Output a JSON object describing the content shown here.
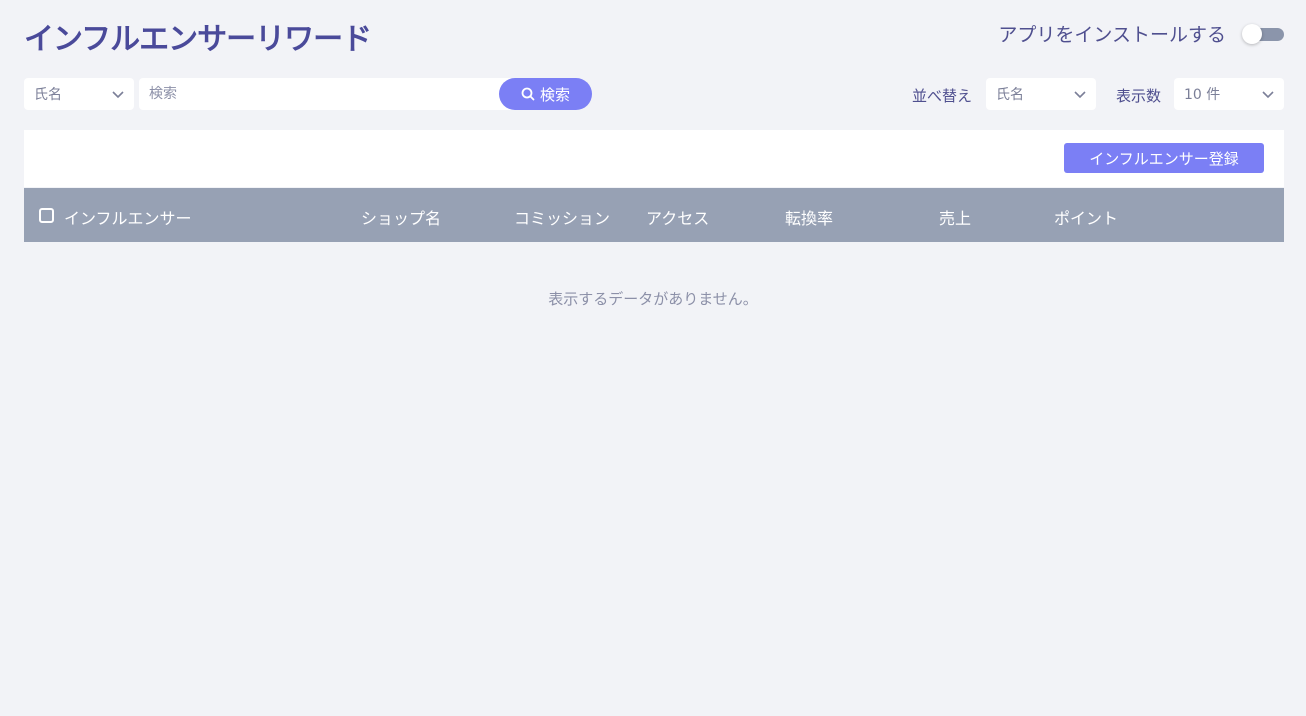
{
  "header": {
    "title": "インフルエンサーリワード",
    "install_label": "アプリをインストールする",
    "install_toggle_on": false
  },
  "toolbar": {
    "filter_select": {
      "selected": "氏名"
    },
    "search": {
      "placeholder": "検索",
      "value": ""
    },
    "search_button_label": "検索",
    "sort_label": "並べ替え",
    "sort_select": {
      "selected": "氏名"
    },
    "count_label": "表示数",
    "count_select": {
      "selected": "10 件"
    }
  },
  "actions": {
    "register_label": "インフルエンサー登録"
  },
  "table": {
    "columns": [
      "インフルエンサー",
      "ショップ名",
      "コミッション",
      "アクセス",
      "転換率",
      "売上",
      "ポイント"
    ],
    "rows": [],
    "empty_message": "表示するデータがありません。"
  },
  "colors": {
    "accent": "#7b7ff5",
    "title": "#4a4a9a",
    "header_bg": "#97a1b4",
    "page_bg": "#f2f3f7"
  },
  "icons": {
    "chevron": "chevron-down-icon",
    "search": "search-icon"
  }
}
